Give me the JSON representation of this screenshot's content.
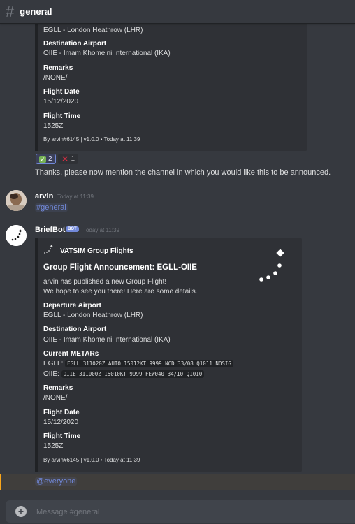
{
  "channel": {
    "hash": "#",
    "name": "general"
  },
  "embed1": {
    "fields": [
      {
        "value": "EGLL - London Heathrow (LHR)"
      },
      {
        "name": "Destination Airport",
        "value": "OIIE - Imam Khomeini International (IKA)"
      },
      {
        "name": "Remarks",
        "value": "/NONE/"
      },
      {
        "name": "Flight Date",
        "value": "15/12/2020"
      },
      {
        "name": "Flight Time",
        "value": "1525Z"
      }
    ],
    "footer": "By arvin#6145 | v1.0.0 • Today at 11:39"
  },
  "reactions": [
    {
      "emoji": "check-mark",
      "count": "2"
    },
    {
      "emoji": "cross-mark",
      "count": "1"
    }
  ],
  "bot_message1": "Thanks, please now mention the channel in which you would like this to be announced.",
  "msg_arvin": {
    "username": "arvin",
    "timestamp": "Today at 11:39",
    "mention": "#general"
  },
  "msg_bot": {
    "username": "BriefBot",
    "tag": "BOT",
    "timestamp": "Today at 11:39",
    "embed": {
      "author": "VATSIM Group Flights",
      "title": "Group Flight Announcement: EGLL-OIIE",
      "description_line1": "arvin has published a new Group Flight!",
      "description_line2": "We hope to see you there! Here are some details.",
      "departure_label": "Departure Airport",
      "departure_value": "EGLL - London Heathrow (LHR)",
      "destination_label": "Destination Airport",
      "destination_value": "OIIE - Imam Khomeini International (IKA)",
      "metars_label": "Current METARs",
      "metar_egll_label": "EGLL:",
      "metar_egll": "EGLL 311020Z AUTO 15012KT 9999 NCD 33/08 Q1011 NOSIG",
      "metar_oiie_label": "OIIE:",
      "metar_oiie": "OIIE 311000Z 15010KT 9999 FEW040 34/10 Q1010",
      "remarks_label": "Remarks",
      "remarks_value": "/NONE/",
      "date_label": "Flight Date",
      "date_value": "15/12/2020",
      "time_label": "Flight Time",
      "time_value": "1525Z",
      "footer": "By arvin#6145 | v1.0.0 • Today at 11:39"
    }
  },
  "mention_everyone": "@everyone",
  "input": {
    "placeholder": "Message #general"
  }
}
